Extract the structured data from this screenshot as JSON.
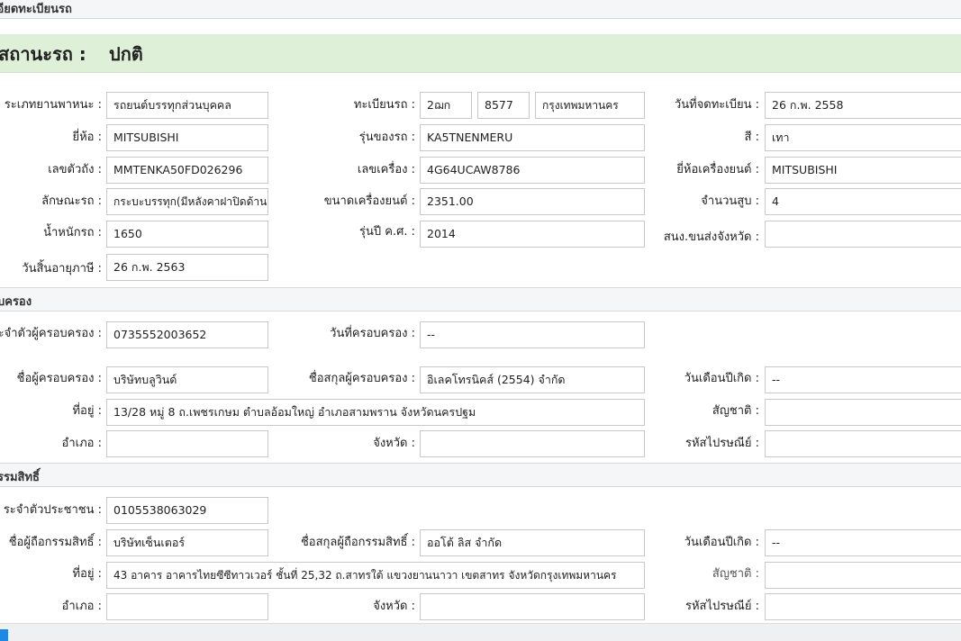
{
  "sections": {
    "vehicle": "เอียดทะเบียนรถ",
    "possession": "บครอง",
    "ownership": "รรมสิทธิ์"
  },
  "status": {
    "label": "สถานะรถ :",
    "value": "ปกติ"
  },
  "vehicle": {
    "type_label": "ระเภทยานพาหนะ :",
    "type": "รถยนต์บรรทุกส่วนบุคคล",
    "plate_label": "ทะเบียนรถ :",
    "plate_prefix": "2ฌก",
    "plate_number": "8577",
    "plate_province": "กรุงเทพมหานคร",
    "reg_date_label": "วันที่จดทะเบียน :",
    "reg_date": "26 ก.พ. 2558",
    "brand_label": "ยี่ห้อ :",
    "brand": "MITSUBISHI",
    "model_label": "รุ่นของรถ :",
    "model": "KA5TNENMERU",
    "color_label": "สี :",
    "color": "เทา",
    "chassis_label": "เลขตัวถัง :",
    "chassis": "MMTENKA50FD026296",
    "engine_no_label": "เลขเครื่อง :",
    "engine_no": "4G64UCAW8786",
    "engine_brand_label": "ยี่ห้อเครื่องยนต์ :",
    "engine_brand": "MITSUBISHI",
    "body_label": "ลักษณะรถ :",
    "body": "กระบะบรรทุก(มีหลังคาฝาปิดด้าน",
    "engine_size_label": "ขนาดเครื่องยนต์ :",
    "engine_size": "2351.00",
    "cylinders_label": "จำนวนสูบ :",
    "cylinders": "4",
    "weight_label": "น้ำหนักรถ :",
    "weight": "1650",
    "year_label": "รุ่นปี ค.ศ. :",
    "year": "2014",
    "office_label": "สนง.ขนส่งจังหวัด :",
    "office": "",
    "expire_label": "วันสิ้นอายุภาษี :",
    "expire": "26 ก.พ. 2563"
  },
  "possessor": {
    "id_label": "ระจำตัวผู้ครอบครอง :",
    "id": "0735552003652",
    "date_label": "วันที่ครอบครอง :",
    "date": "--",
    "name_label": "ชื่อผู้ครอบครอง :",
    "name": "บริษัทบลูวินด์",
    "company_label": "ชื่อสกุลผู้ครอบครอง :",
    "company": "อิเลคโทรนิคส์ (2554)  จำกัด",
    "birth_label": "วันเดือนปีเกิด :",
    "birth": "--",
    "address_label": "ที่อยู่ :",
    "address": "13/28    หมู่ 8    ถ.เพชรเกษม ตำบลอ้อมใหญ่ อำเภอสามพราน จังหวัดนครปฐม",
    "nationality_label": "สัญชาติ :",
    "nationality": "",
    "district_label": "อำเภอ :",
    "district": "",
    "province_label": "จังหวัด :",
    "province": "",
    "postcode_label": "รหัสไปรษณีย์ :",
    "postcode": ""
  },
  "owner": {
    "id_label": "ระจำตัวประชาชน :",
    "id": "0105538063029",
    "name_label": "ชื่อผู้ถือกรรมสิทธิ์ :",
    "name": "บริษัทเซ็นเตอร์",
    "company_label": "ชื่อสกุลผู้ถือกรรมสิทธิ์ :",
    "company": "ออโต้ ลิส  จำกัด",
    "birth_label": "วันเดือนปีเกิด :",
    "birth": "--",
    "address_label": "ที่อยู่ :",
    "address": "43  อาคาร อาคารไทยซีซีทาวเวอร์ ชั้นที่ 25,32      ถ.สาทรใต้ แขวงยานนาวา เขตสาทร จังหวัดกรุงเทพมหานคร",
    "nationality_label": "สัญชาติ :",
    "nationality": "",
    "district_label": "อำเภอ :",
    "district": "",
    "province_label": "จังหวัด :",
    "province": "",
    "postcode_label": "รหัสไปรษณีย์ :",
    "postcode": ""
  }
}
